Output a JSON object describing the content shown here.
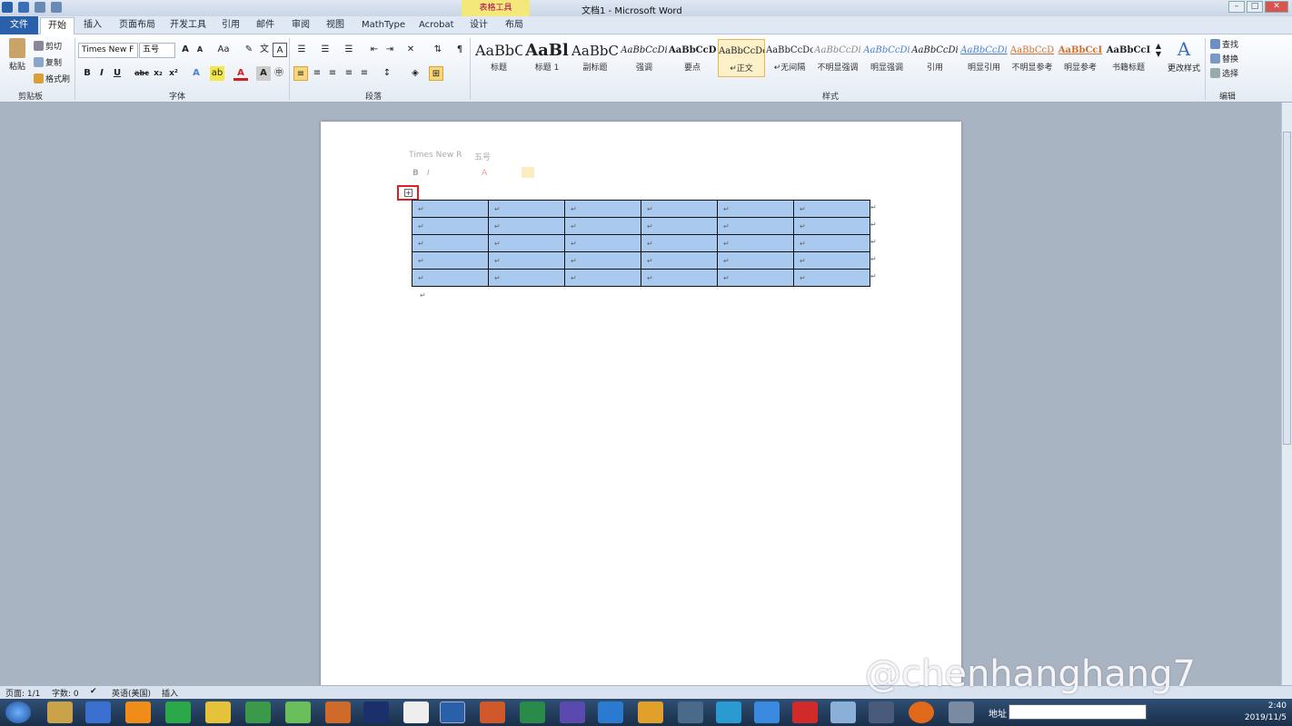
{
  "titlebar": {
    "title": "文档1  -  Microsoft Word",
    "context_tab": "表格工具"
  },
  "tabs": {
    "file": "文件",
    "home": "开始",
    "items": [
      "插入",
      "页面布局",
      "开发工具",
      "引用",
      "邮件",
      "审阅",
      "视图",
      "MathType",
      "Acrobat",
      "设计",
      "布局"
    ]
  },
  "clipboard": {
    "paste": "粘贴",
    "cut": "剪切",
    "copy": "复制",
    "format_painter": "格式刷",
    "label": "剪贴板"
  },
  "font": {
    "name": "Times New F",
    "size": "五号",
    "label": "字体",
    "case": "Aa"
  },
  "paragraph": {
    "label": "段落"
  },
  "styles": {
    "label": "样式",
    "items": [
      {
        "sample": "AaBbC",
        "label": "标题"
      },
      {
        "sample": "AaBl",
        "label": "标题 1"
      },
      {
        "sample": "AaBbC",
        "label": "副标题"
      },
      {
        "sample": "AaBbCcDi",
        "label": "强调"
      },
      {
        "sample": "AaBbCcD",
        "label": "要点"
      },
      {
        "sample": "AaBbCcDc",
        "label": "↵正文"
      },
      {
        "sample": "AaBbCcDc",
        "label": "↵无间隔"
      },
      {
        "sample": "AaBbCcDi",
        "label": "不明显强调"
      },
      {
        "sample": "AaBbCcDi",
        "label": "明显强调"
      },
      {
        "sample": "AaBbCcDi",
        "label": "引用"
      },
      {
        "sample": "AaBbCcDi",
        "label": "明显引用"
      },
      {
        "sample": "AaBbCcD",
        "label": "不明显参考"
      },
      {
        "sample": "AaBbCcI",
        "label": "明显参考"
      },
      {
        "sample": "AaBbCcI",
        "label": "书籍标题"
      }
    ],
    "change": "更改样式"
  },
  "editing": {
    "find": "查找",
    "replace": "替换",
    "select": "选择",
    "label": "编辑"
  },
  "mini_toolbar": {
    "font": "Times New R",
    "size": "五号"
  },
  "table": {
    "rows": 5,
    "cols": 6,
    "cell_mark": "↵"
  },
  "end_mark": "↵",
  "status": {
    "page": "页面: 1/1",
    "words": "字数: 0",
    "language": "英语(美国)",
    "mode": "插入"
  },
  "watermark": "@chenhanghang7",
  "taskbar": {
    "address_label": "地址",
    "time": "2:40",
    "date": "2019/11/5"
  },
  "colors": {
    "file_tab": "#2a5faa",
    "table_selection": "#a9c9ee",
    "highlight_box": "#e02020"
  }
}
